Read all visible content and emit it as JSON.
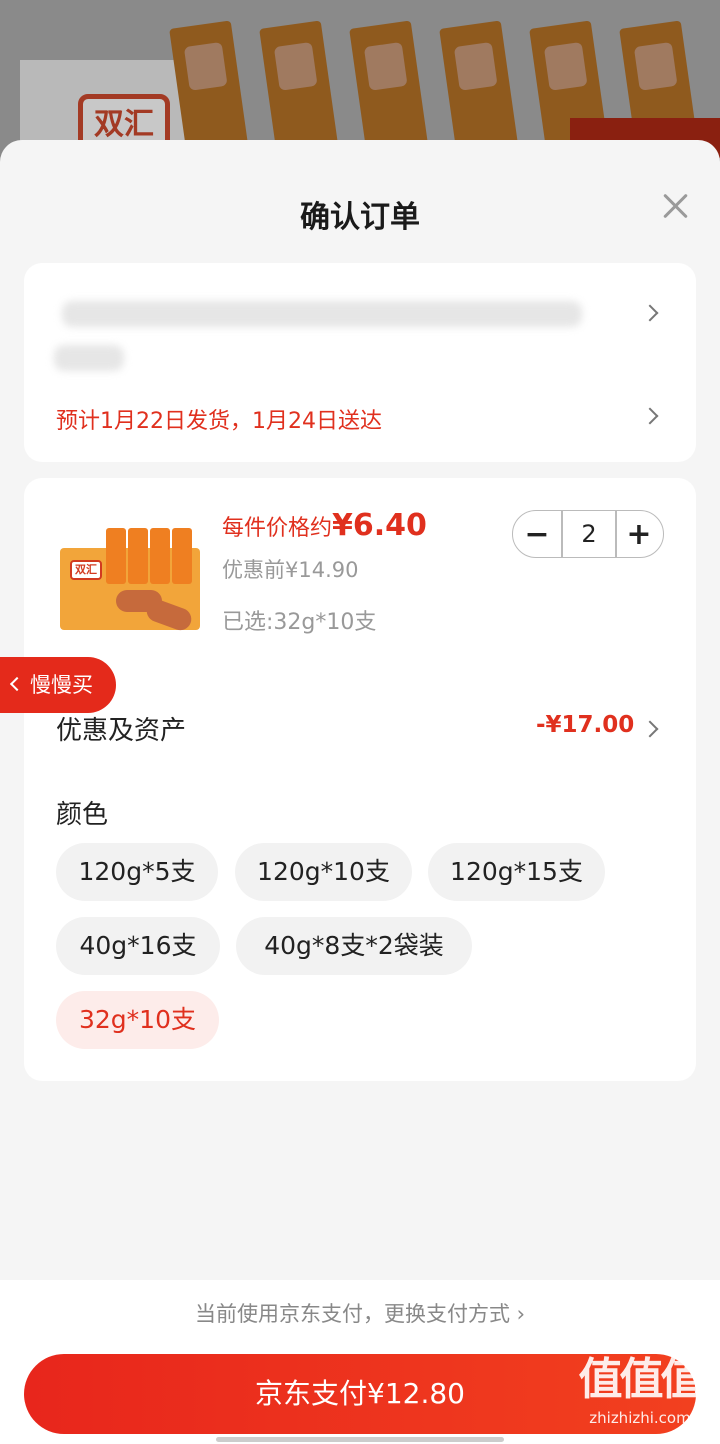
{
  "sheet": {
    "title": "确认订单"
  },
  "address": {
    "delivery_text": "预计1月22日发货，1月24日送达"
  },
  "product": {
    "price_prefix": "每件价格约",
    "price_value": "¥6.40",
    "original_price": "优惠前¥14.90",
    "selected_spec": "已选:32g*10支",
    "quantity": "2",
    "minus_label": "−",
    "plus_label": "+",
    "thumb_logo": "双汇"
  },
  "assets": {
    "label": "优惠及资产",
    "value": "-¥17.00"
  },
  "color": {
    "label": "颜色",
    "options": [
      "120g*5支",
      "120g*10支",
      "120g*15支",
      "40g*16支",
      "40g*8支*2袋装",
      "32g*10支"
    ],
    "selected": "32g*10支"
  },
  "slow_buy": {
    "label": "慢慢买"
  },
  "footer": {
    "pay_hint": "当前使用京东支付，更换支付方式 ›",
    "pay_button": "京东支付¥12.80"
  },
  "background": {
    "logo": "双汇"
  },
  "watermark": {
    "main": "值值值",
    "sub": "zhizhizhi.com"
  },
  "colors": {
    "accent": "#e0301e",
    "button": "#e8261c",
    "chip_bg": "#f2f2f2",
    "chip_selected_bg": "#fdecea"
  },
  "icons": [
    "close-icon",
    "chevron-right-icon",
    "minus-icon",
    "plus-icon",
    "chevron-left-icon"
  ]
}
